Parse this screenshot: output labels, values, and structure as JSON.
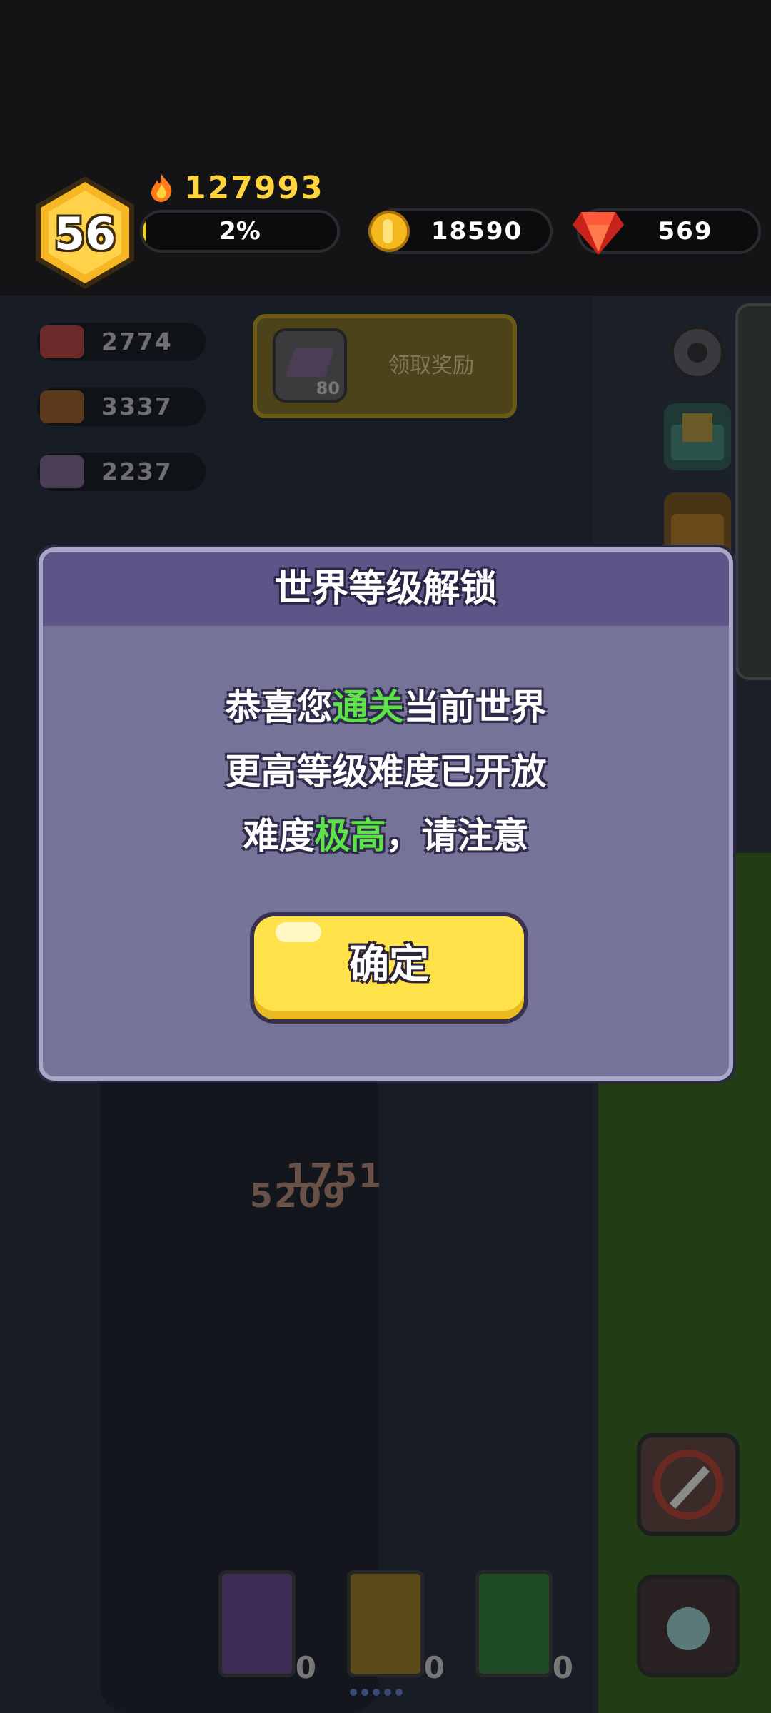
{
  "player": {
    "level": "56",
    "power": "127993",
    "xp_percent_label": "2%",
    "xp_fraction": 0.02
  },
  "currency": {
    "gold": "18590",
    "gems": "569"
  },
  "resources": [
    {
      "name": "meat",
      "value": "2774"
    },
    {
      "name": "wood",
      "value": "3337"
    },
    {
      "name": "ingot",
      "value": "2237"
    }
  ],
  "claim_reward": {
    "label": "领取奖励",
    "item_count": "80"
  },
  "damage_numbers": [
    "1751",
    "5209"
  ],
  "skill_books": [
    {
      "name": "lightning-book",
      "count": "0",
      "color": "#4b3a6e"
    },
    {
      "name": "wing-book",
      "count": "0",
      "color": "#6e5a1e"
    },
    {
      "name": "heal-book",
      "count": "0",
      "color": "#1f5a2a"
    }
  ],
  "dialog": {
    "title": "世界等级解锁",
    "line1_pre": "恭喜您",
    "line1_hl": "通关",
    "line1_post": "当前世界",
    "line2": "更高等级难度已开放",
    "line3_pre": "难度",
    "line3_hl": "极高",
    "line3_post": "，请注意",
    "confirm": "确定"
  },
  "colors": {
    "highlight": "#5ee24a",
    "power": "#ffd33d",
    "dialog_bg": "#767398",
    "button": "#ffe14a"
  }
}
